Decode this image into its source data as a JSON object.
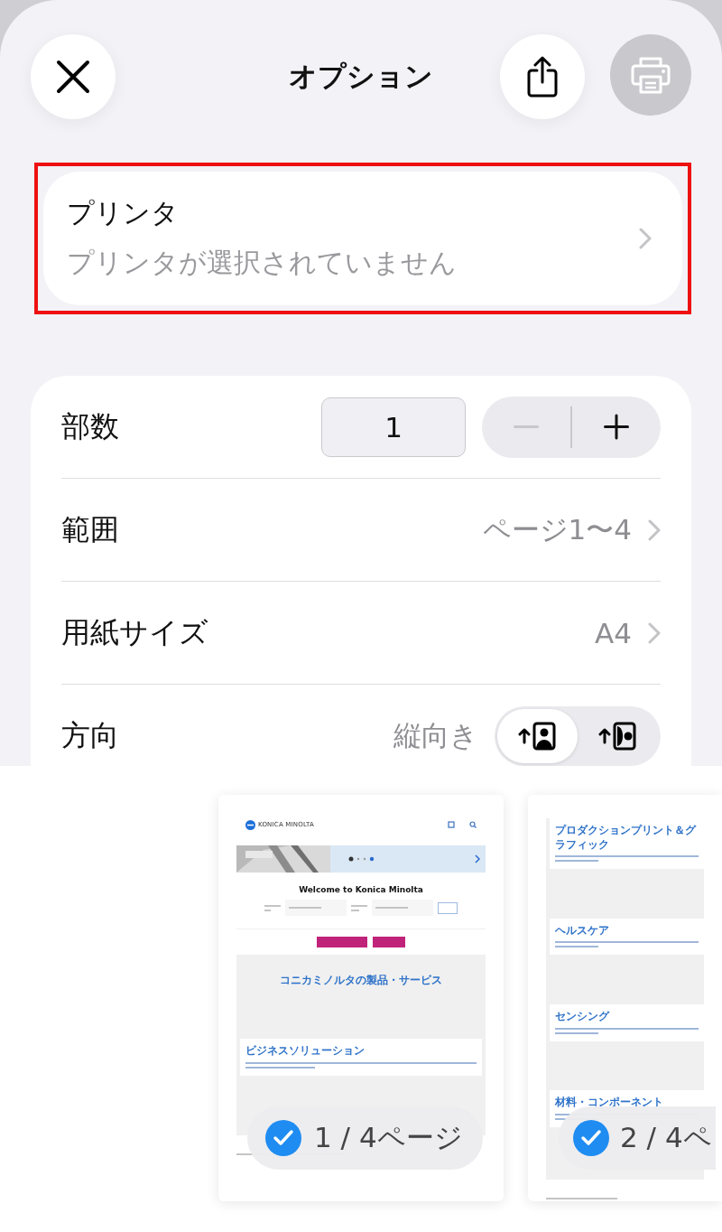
{
  "header": {
    "title": "オプション",
    "buttons": [
      {
        "kind": "close",
        "disabled": false
      },
      {
        "kind": "share",
        "disabled": false
      },
      {
        "kind": "print",
        "disabled": true
      }
    ]
  },
  "printer": {
    "label": "プリンタ",
    "value": "プリンタが選択されていません",
    "highlighted": true
  },
  "settings": [
    {
      "kind": "stepper",
      "label": "部数",
      "value": "1",
      "minus_disabled": true
    },
    {
      "kind": "link",
      "label": "範囲",
      "value": "ページ1〜4"
    },
    {
      "kind": "link",
      "label": "用紙サイズ",
      "value": "A4"
    },
    {
      "kind": "orientation",
      "label": "方向",
      "value": "縦向き",
      "options": [
        {
          "kind": "portrait",
          "selected": true
        },
        {
          "kind": "landscape",
          "selected": false
        }
      ]
    }
  ],
  "previews": [
    {
      "kind": "home",
      "badge": "1 / 4ページ",
      "checked": true,
      "logo": "KONICA MINOLTA",
      "welcome": "Welcome to Konica Minolta",
      "section_title": "コニカミノルタの製品・サービス",
      "cards": [
        "ビジネスソリューション"
      ]
    },
    {
      "kind": "sections",
      "badge": "2 / 4ペ",
      "checked": true,
      "cards": [
        "プロダクションプリント＆グラフィック",
        "ヘルスケア",
        "センシング",
        "材料・コンポーネント"
      ]
    }
  ]
}
